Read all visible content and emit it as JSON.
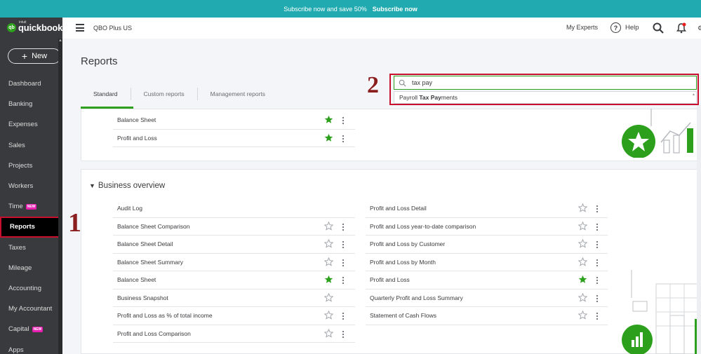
{
  "banner": {
    "text": "Subscribe now and save 50%",
    "cta": "Subscribe now"
  },
  "logo": {
    "intuit": "intuit",
    "brand": "quickbooks",
    "mark": "qb"
  },
  "new_button": {
    "label": "New"
  },
  "nav": [
    {
      "label": "Dashboard",
      "chevron": false
    },
    {
      "label": "Banking",
      "chevron": true
    },
    {
      "label": "Expenses",
      "chevron": true
    },
    {
      "label": "Sales",
      "chevron": true
    },
    {
      "label": "Projects",
      "chevron": false
    },
    {
      "label": "Workers",
      "chevron": true
    },
    {
      "label": "Time",
      "badge": "NEW",
      "chevron": true
    },
    {
      "label": "Reports",
      "active": true,
      "chevron": false
    },
    {
      "label": "Taxes",
      "chevron": true
    },
    {
      "label": "Mileage",
      "chevron": false
    },
    {
      "label": "Accounting",
      "chevron": true
    },
    {
      "label": "My Accountant",
      "chevron": false
    },
    {
      "label": "Capital",
      "badge": "NEW",
      "chevron": true
    },
    {
      "label": "Apps",
      "chevron": false
    }
  ],
  "topbar": {
    "company": "QBO Plus US",
    "my_experts": "My Experts",
    "help": "Help",
    "help_glyph": "?"
  },
  "page": {
    "title": "Reports"
  },
  "tabs": [
    {
      "label": "Standard",
      "active": true
    },
    {
      "label": "Custom reports"
    },
    {
      "label": "Management reports"
    }
  ],
  "search": {
    "value": "tax pay",
    "suggestion_prefix": "Payroll ",
    "suggestion_bold1": "Tax Pay",
    "suggestion_suffix": "ments"
  },
  "annotations": {
    "step1": "1",
    "step2": "2"
  },
  "favorites": [
    {
      "label": "Balance Sheet",
      "favorite": true
    },
    {
      "label": "Profit and Loss",
      "favorite": true
    }
  ],
  "business_overview": {
    "title": "Business overview",
    "left": [
      {
        "label": "Audit Log",
        "favorite": null
      },
      {
        "label": "Balance Sheet Comparison",
        "favorite": false
      },
      {
        "label": "Balance Sheet Detail",
        "favorite": false
      },
      {
        "label": "Balance Sheet Summary",
        "favorite": false
      },
      {
        "label": "Balance Sheet",
        "favorite": true
      },
      {
        "label": "Business Snapshot",
        "favorite": false,
        "no_menu": true
      },
      {
        "label": "Profit and Loss as % of total income",
        "favorite": false
      },
      {
        "label": "Profit and Loss Comparison",
        "favorite": false
      }
    ],
    "right": [
      {
        "label": "Profit and Loss Detail",
        "favorite": false
      },
      {
        "label": "Profit and Loss year-to-date comparison",
        "favorite": false
      },
      {
        "label": "Profit and Loss by Customer",
        "favorite": false
      },
      {
        "label": "Profit and Loss by Month",
        "favorite": false
      },
      {
        "label": "Profit and Loss",
        "favorite": true
      },
      {
        "label": "Quarterly Profit and Loss Summary",
        "favorite": false
      },
      {
        "label": "Statement of Cash Flows",
        "favorite": false
      }
    ]
  },
  "colors": {
    "accent": "#2ca01c",
    "banner": "#21abb0",
    "sidebar": "#393a3d",
    "highlight": "#c8102e"
  }
}
